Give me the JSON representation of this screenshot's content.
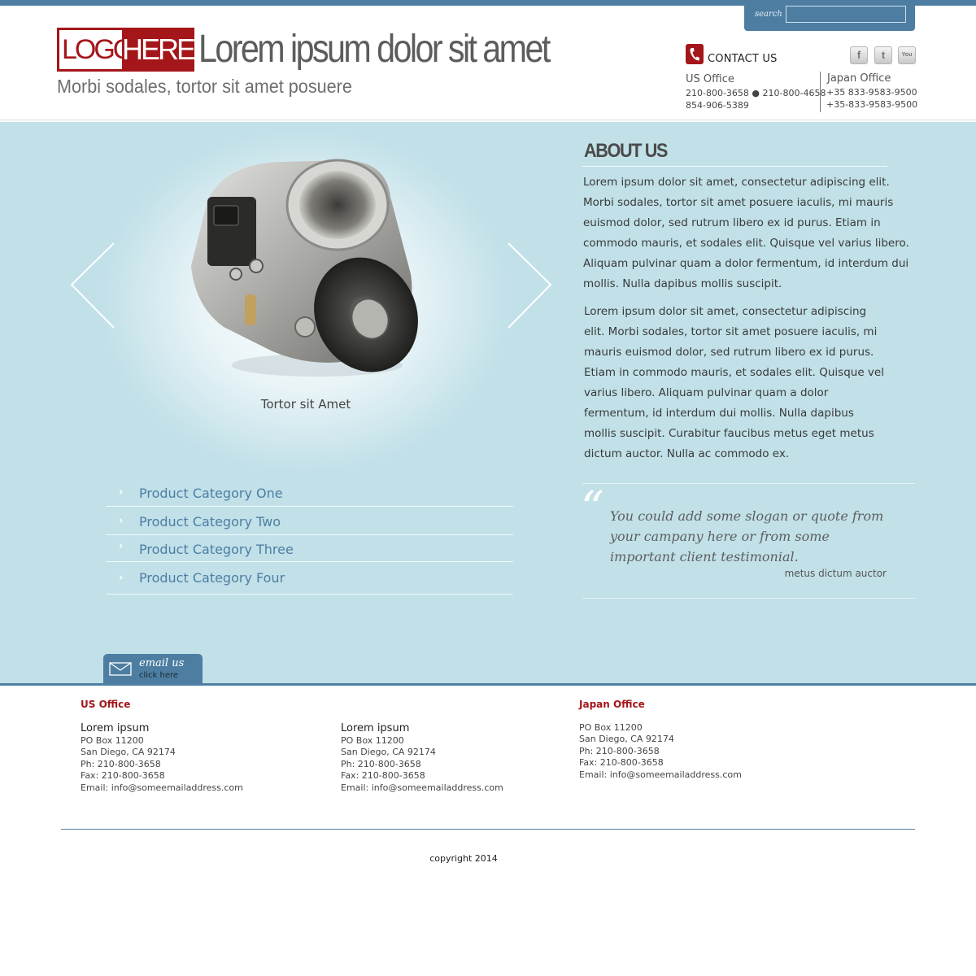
{
  "search": {
    "label": "search",
    "value": ""
  },
  "header": {
    "logo_left": "LOGO",
    "logo_right": "HERE",
    "title": "Lorem ipsum dolor sit amet",
    "tagline": "Morbi sodales, tortor sit amet posuere",
    "contact_label": "CONTACT US",
    "social_icons": [
      "facebook-icon",
      "twitter-icon",
      "youtube-icon"
    ],
    "social_glyphs": {
      "facebook": "f",
      "twitter": "t",
      "youtube": "You"
    },
    "us_office": {
      "title": "US Office",
      "line1": "210-800-3658 ● 210-800-4658",
      "line2": "854-906-5389"
    },
    "japan_office": {
      "title": "Japan Office",
      "line1": "+35 833-9583-9500",
      "line2": "+35-833-9583-9500"
    }
  },
  "slider": {
    "caption": "Tortor sit Amet",
    "prev_icon": "chevron-left-icon",
    "next_icon": "chevron-right-icon"
  },
  "categories": [
    "Product Category One",
    "Product Category Two",
    "Product Category Three",
    "Product Category Four"
  ],
  "about": {
    "title": "ABOUT US",
    "p1": "Lorem ipsum dolor sit amet, consectetur adipiscing elit. Morbi sodales, tortor sit amet posuere iaculis, mi mauris euismod dolor, sed rutrum libero ex id purus. Etiam in commodo mauris, et sodales elit. Quisque vel varius libero. Aliquam pulvinar quam a dolor fermentum, id interdum dui mollis. Nulla dapibus mollis suscipit.",
    "p2": "Lorem ipsum dolor sit amet, consectetur adipiscing elit. Morbi sodales, tortor sit amet posuere iaculis, mi mauris euismod dolor, sed rutrum libero ex id purus. Etiam in commodo mauris, et sodales elit. Quisque vel varius libero. Aliquam pulvinar quam a dolor fermentum, id interdum dui mollis. Nulla dapibus mollis suscipit. Curabitur faucibus metus eget metus dictum auctor. Nulla ac commodo ex."
  },
  "quote": {
    "mark": "“",
    "text": "You could add some slogan or quote from your campany here or from some important client testimonial.",
    "author": "metus dictum auctor"
  },
  "email_tab": {
    "label": "email us",
    "sub": "click here"
  },
  "footer": {
    "col1": {
      "heading": "US Office",
      "name": "Lorem ipsum",
      "lines": [
        "PO Box 11200",
        "San Diego, CA 92174",
        "Ph: 210-800-3658",
        "Fax: 210-800-3658",
        "Email: info@someemailaddress.com"
      ]
    },
    "col2": {
      "name": "Lorem ipsum",
      "lines": [
        "PO Box 11200",
        "San Diego, CA 92174",
        "Ph: 210-800-3658",
        "Fax: 210-800-3658",
        "Email: info@someemailaddress.com"
      ]
    },
    "col3": {
      "heading": "Japan Office",
      "lines": [
        "PO Box 11200",
        "San Diego, CA 92174",
        "Ph: 210-800-3658",
        "Fax: 210-800-3658",
        "Email: info@someemailaddress.com"
      ]
    },
    "copyright": "copyright 2014"
  },
  "colors": {
    "brand_red": "#a4161a",
    "accent_blue": "#4d7ea2",
    "panel_bg": "#c1e0e8"
  }
}
